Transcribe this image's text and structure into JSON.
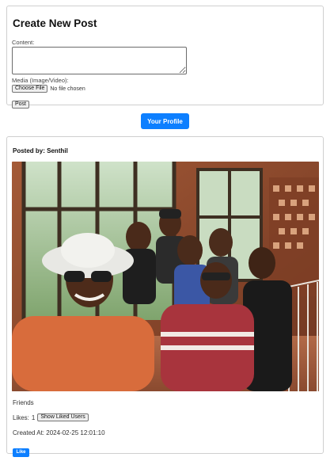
{
  "create_post": {
    "title": "Create New Post",
    "content_label": "Content:",
    "content_value": "",
    "media_label": "Media (Image/Video):",
    "choose_file_label": "Choose File",
    "file_status": "No file chosen",
    "post_button_label": "Post"
  },
  "profile_button_label": "Your Profile",
  "post": {
    "posted_by_label": "Posted by:",
    "author": "Senthil",
    "caption": "Friends",
    "likes_label": "Likes:",
    "likes_count": "1",
    "show_liked_users_label": "Show Liked Users",
    "created_label": "Created At:",
    "created_at": "2024-02-25 12:01:10",
    "like_button_label": "Like"
  },
  "colors": {
    "primary_button": "#0d7fff",
    "card_border": "#cfcfcf"
  }
}
